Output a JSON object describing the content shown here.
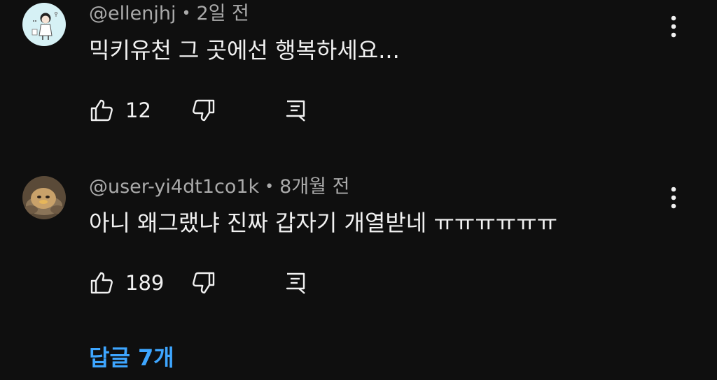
{
  "comments": [
    {
      "author": "@ellenjhj",
      "separator": "•",
      "time": "2일 전",
      "text": "믹키유천 그 곳에선 행복하세요...",
      "likes": "12",
      "avatar_icon": "cartoon-girl-avatar"
    },
    {
      "author": "@user-yi4dt1co1k",
      "separator": "•",
      "time": "8개월 전",
      "text": "아니 왜그랬냐 진짜 갑자기 개열받네 ㅠㅠㅠㅠㅠㅠ",
      "likes": "189",
      "avatar_icon": "plush-toy-avatar"
    }
  ],
  "replies_label": "답글 7개",
  "icons": {
    "like": "thumbs-up-icon",
    "dislike": "thumbs-down-icon",
    "reply": "reply-icon",
    "more": "more-vertical-icon"
  },
  "colors": {
    "background": "#0f0f0f",
    "text": "#f1f1f1",
    "secondary_text": "#aaaaaa",
    "link": "#3ea6ff"
  }
}
